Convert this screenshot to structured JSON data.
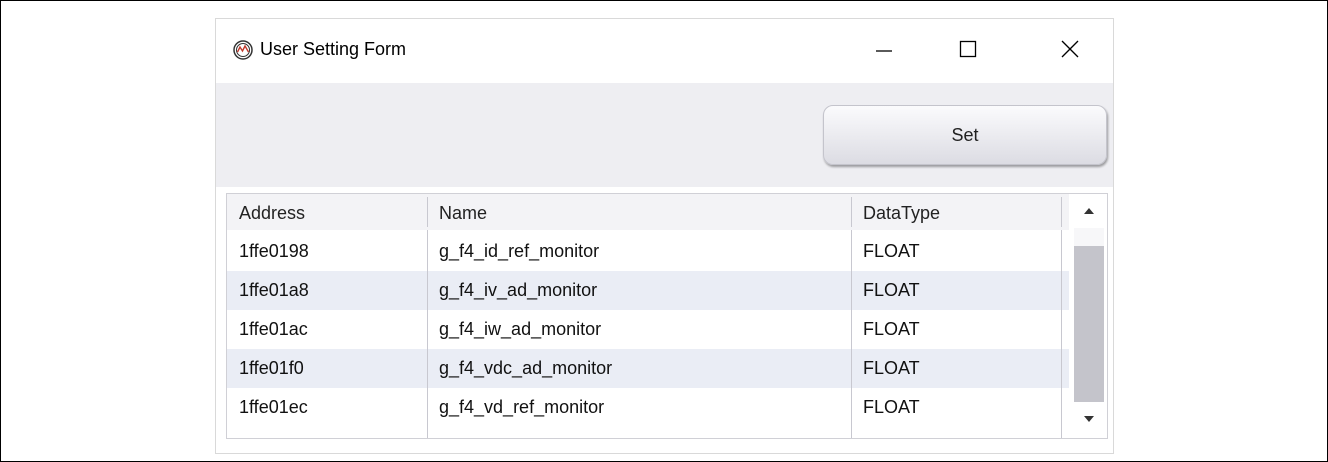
{
  "window": {
    "title": "User Setting Form",
    "icon": "app-logo-icon",
    "controls": {
      "minimize": "minimize-icon",
      "maximize": "maximize-icon",
      "close": "close-icon"
    }
  },
  "toolbar": {
    "set_label": "Set"
  },
  "grid": {
    "columns": [
      "Address",
      "Name",
      "DataType"
    ],
    "rows": [
      {
        "address": "1ffe0198",
        "name": "g_f4_id_ref_monitor",
        "datatype": "FLOAT"
      },
      {
        "address": "1ffe01a8",
        "name": "g_f4_iv_ad_monitor",
        "datatype": "FLOAT"
      },
      {
        "address": "1ffe01ac",
        "name": "g_f4_iw_ad_monitor",
        "datatype": "FLOAT"
      },
      {
        "address": "1ffe01f0",
        "name": "g_f4_vdc_ad_monitor",
        "datatype": "FLOAT"
      },
      {
        "address": "1ffe01ec",
        "name": "g_f4_vd_ref_monitor",
        "datatype": "FLOAT"
      }
    ],
    "scrollbar": {
      "up_icon": "arrow-up-icon",
      "down_icon": "arrow-down-icon"
    }
  },
  "colors": {
    "toolbar_bg": "#eeeef2",
    "row_alt_bg": "#eaedf5",
    "header_bg": "#f3f3f6"
  }
}
